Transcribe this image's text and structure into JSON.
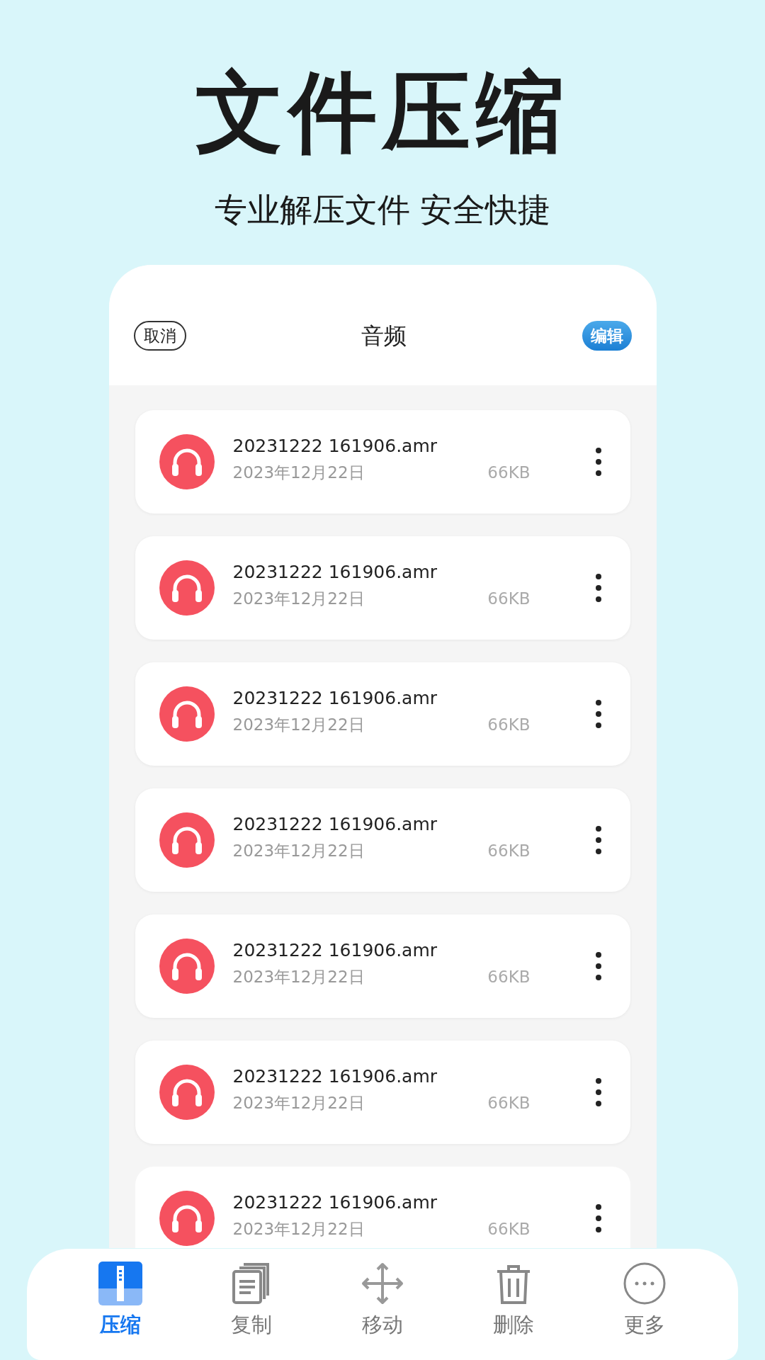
{
  "headline": "文件压缩",
  "tagline": "专业解压文件 安全快捷",
  "header": {
    "cancel": "取消",
    "title": "音频",
    "edit": "编辑"
  },
  "files": [
    {
      "name": "20231222 161906.amr",
      "date": "2023年12月22日",
      "size": "66KB"
    },
    {
      "name": "20231222 161906.amr",
      "date": "2023年12月22日",
      "size": "66KB"
    },
    {
      "name": "20231222 161906.amr",
      "date": "2023年12月22日",
      "size": "66KB"
    },
    {
      "name": "20231222 161906.amr",
      "date": "2023年12月22日",
      "size": "66KB"
    },
    {
      "name": "20231222 161906.amr",
      "date": "2023年12月22日",
      "size": "66KB"
    },
    {
      "name": "20231222 161906.amr",
      "date": "2023年12月22日",
      "size": "66KB"
    },
    {
      "name": "20231222 161906.amr",
      "date": "2023年12月22日",
      "size": "66KB"
    }
  ],
  "bottom_bar": [
    {
      "kind": "compress",
      "label": "压缩",
      "selected": true
    },
    {
      "kind": "copy",
      "label": "复制",
      "selected": false
    },
    {
      "kind": "move",
      "label": "移动",
      "selected": false
    },
    {
      "kind": "delete",
      "label": "删除",
      "selected": false
    },
    {
      "kind": "more",
      "label": "更多",
      "selected": false
    }
  ]
}
